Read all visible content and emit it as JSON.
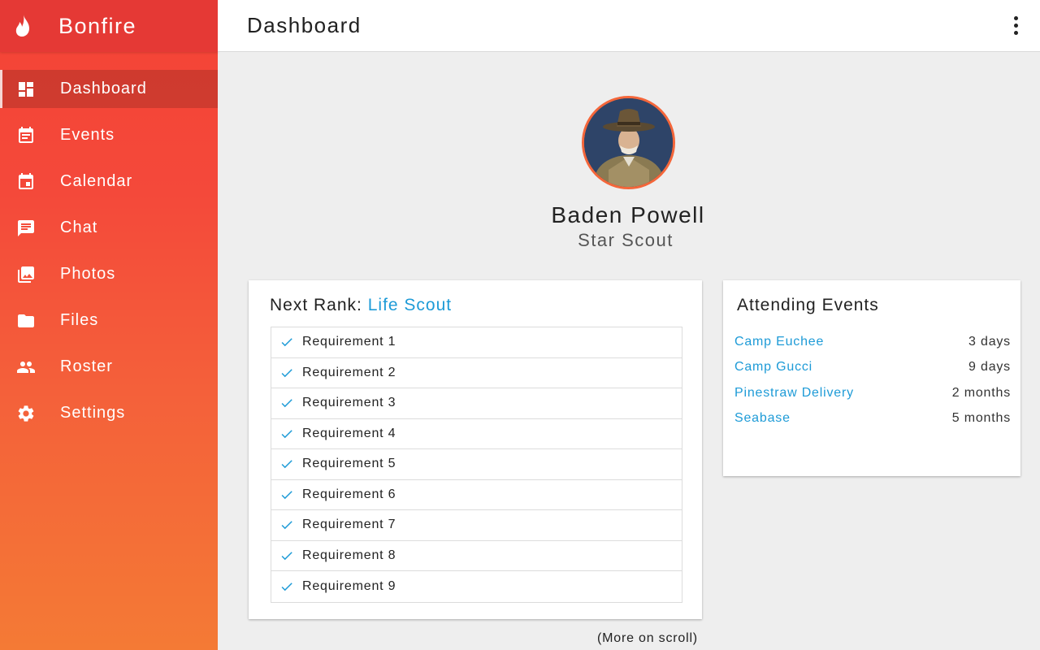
{
  "app": {
    "name": "Bonfire",
    "accent": "#f44336",
    "link_color": "#1e9bd7"
  },
  "sidebar": {
    "items": [
      {
        "label": "Dashboard",
        "icon": "dashboard-icon",
        "active": true
      },
      {
        "label": "Events",
        "icon": "event-note-icon"
      },
      {
        "label": "Calendar",
        "icon": "calendar-icon"
      },
      {
        "label": "Chat",
        "icon": "chat-icon"
      },
      {
        "label": "Photos",
        "icon": "photos-icon"
      },
      {
        "label": "Files",
        "icon": "folder-icon"
      },
      {
        "label": "Roster",
        "icon": "people-icon"
      },
      {
        "label": "Settings",
        "icon": "gear-icon"
      }
    ]
  },
  "header": {
    "title": "Dashboard",
    "menu_icon": "more-vert-icon"
  },
  "profile": {
    "name": "Baden Powell",
    "rank": "Star Scout"
  },
  "next_rank": {
    "prefix": "Next Rank: ",
    "rank": "Life Scout",
    "requirements": [
      "Requirement 1",
      "Requirement 2",
      "Requirement 3",
      "Requirement 4",
      "Requirement 5",
      "Requirement 6",
      "Requirement 7",
      "Requirement 8",
      "Requirement 9"
    ]
  },
  "attending": {
    "title": "Attending Events",
    "events": [
      {
        "name": "Camp Euchee",
        "time": "3 days"
      },
      {
        "name": "Camp Gucci",
        "time": "9 days"
      },
      {
        "name": "Pinestraw Delivery",
        "time": "2 months"
      },
      {
        "name": "Seabase",
        "time": "5 months"
      }
    ]
  },
  "scroll_hint": "(More on scroll)"
}
